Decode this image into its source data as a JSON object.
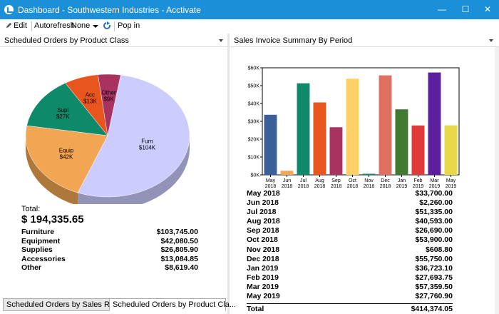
{
  "window": {
    "title": "Dashboard - Southwestern Industries - Acctivate",
    "min_glyph": "—",
    "max_glyph": "☐",
    "close_glyph": "✕"
  },
  "toolbar": {
    "edit_label": "Edit",
    "autorefresh_label": "Autorefresh",
    "autorefresh_value": "None",
    "popin_label": "Pop in"
  },
  "left_panel": {
    "title": "Scheduled Orders by Product Class",
    "total_label": "Total:",
    "total_value": "$ 194,335.65",
    "rows": [
      {
        "name": "Furniture",
        "amount": "$103,745.00"
      },
      {
        "name": "Equipment",
        "amount": "$42,080.50"
      },
      {
        "name": "Supplies",
        "amount": "$26,805.90"
      },
      {
        "name": "Accessories",
        "amount": "$13,084.85"
      },
      {
        "name": "Other",
        "amount": "$8,619.40"
      }
    ]
  },
  "pie_chart": {
    "type": "pie",
    "slices": [
      {
        "label": "Furn",
        "value_label": "$104K",
        "value": 103745.0,
        "color": "#ccccff"
      },
      {
        "label": "Equip",
        "value_label": "$42K",
        "value": 42080.5,
        "color": "#f2a654"
      },
      {
        "label": "Supl",
        "value_label": "$27K",
        "value": 26805.9,
        "color": "#0e8a6a"
      },
      {
        "label": "Acc",
        "value_label": "$13K",
        "value": 13084.85,
        "color": "#e8561e"
      },
      {
        "label": "Other",
        "value_label": "$9K",
        "value": 8619.4,
        "color": "#a83260"
      }
    ]
  },
  "right_panel": {
    "title": "Sales Invoice Summary By Period",
    "rows": [
      {
        "period": "May 2018",
        "amount": "$33,700.00"
      },
      {
        "period": "Jun 2018",
        "amount": "$2,260.00"
      },
      {
        "period": "Jul 2018",
        "amount": "$51,335.00"
      },
      {
        "period": "Aug 2018",
        "amount": "$40,593.00"
      },
      {
        "period": "Sep 2018",
        "amount": "$26,690.00"
      },
      {
        "period": "Oct 2018",
        "amount": "$53,900.00"
      },
      {
        "period": "Nov 2018",
        "amount": "$608.80"
      },
      {
        "period": "Dec 2018",
        "amount": "$55,750.00"
      },
      {
        "period": "Jan 2019",
        "amount": "$36,723.10"
      },
      {
        "period": "Feb 2019",
        "amount": "$27,693.75"
      },
      {
        "period": "Mar 2019",
        "amount": "$57,359.50"
      },
      {
        "period": "May 2019",
        "amount": "$27,760.90"
      }
    ],
    "total_label": "Total",
    "total_value": "$414,374.05"
  },
  "chart_data": {
    "type": "bar",
    "categories": [
      [
        "May",
        "2018"
      ],
      [
        "Jun",
        "2018"
      ],
      [
        "Jul",
        "2018"
      ],
      [
        "Aug",
        "2018"
      ],
      [
        "Sep",
        "2018"
      ],
      [
        "Oct",
        "2018"
      ],
      [
        "Nov",
        "2018"
      ],
      [
        "Dec",
        "2018"
      ],
      [
        "Jan",
        "2019"
      ],
      [
        "Feb",
        "2019"
      ],
      [
        "Mar",
        "2019"
      ],
      [
        "May",
        "2019"
      ]
    ],
    "values": [
      33700.0,
      2260.0,
      51335.0,
      40593.0,
      26690.0,
      53900.0,
      608.8,
      55750.0,
      36723.1,
      27693.75,
      57359.5,
      27760.9
    ],
    "colors": [
      "#3b5f99",
      "#f2a654",
      "#0e8a6a",
      "#e8561e",
      "#a83260",
      "#fdd068",
      "#0e8a6a",
      "#e07060",
      "#3f7a30",
      "#e03a3a",
      "#5c1fa0",
      "#e8d848"
    ],
    "ylim": [
      0,
      60000
    ],
    "yticks": [
      "$0K",
      "$10K",
      "$20K",
      "$30K",
      "$40K",
      "$50K",
      "$60K"
    ],
    "grid": false
  },
  "tabs": [
    {
      "label": "Scheduled Orders by Sales Rep",
      "active": false
    },
    {
      "label": "Scheduled Orders by Product Cla...",
      "active": true
    }
  ]
}
